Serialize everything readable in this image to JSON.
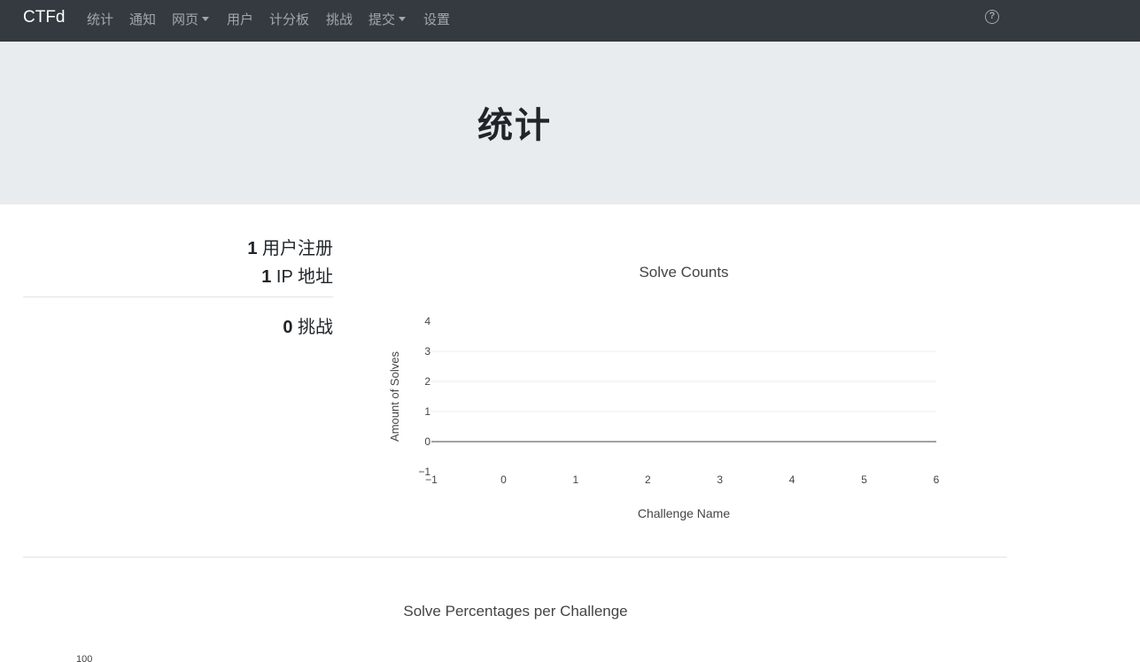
{
  "navbar": {
    "brand": "CTFd",
    "items": [
      {
        "label": "统计",
        "dropdown": false
      },
      {
        "label": "通知",
        "dropdown": false
      },
      {
        "label": "网页",
        "dropdown": true
      },
      {
        "label": "用户",
        "dropdown": false
      },
      {
        "label": "计分板",
        "dropdown": false
      },
      {
        "label": "挑战",
        "dropdown": false
      },
      {
        "label": "提交",
        "dropdown": true
      },
      {
        "label": "设置",
        "dropdown": false
      }
    ],
    "help_icon": "question-circle-icon",
    "help_glyph": "?"
  },
  "page": {
    "title": "统计"
  },
  "stats": {
    "users_count": "1",
    "users_label": "用户注册",
    "ips_count": "1",
    "ips_label": "IP 地址",
    "challenges_count": "0",
    "challenges_label": "挑战"
  },
  "chart_data": [
    {
      "type": "bar",
      "title": "Solve Counts",
      "xlabel": "Challenge Name",
      "ylabel": "Amount of Solves",
      "categories": [],
      "values": [],
      "xlim": [
        -1,
        6
      ],
      "ylim": [
        -1,
        4
      ],
      "x_ticks": [
        "−1",
        "0",
        "1",
        "2",
        "3",
        "4",
        "5",
        "6"
      ],
      "y_ticks": [
        "−1",
        "0",
        "1",
        "2",
        "3",
        "4"
      ],
      "grid": true
    },
    {
      "type": "bar",
      "title": "Solve Percentages per Challenge",
      "categories": [],
      "values": [],
      "y_ticks": [
        "100"
      ]
    }
  ]
}
